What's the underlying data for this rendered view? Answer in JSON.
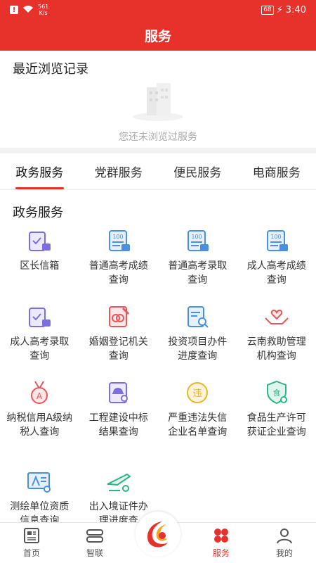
{
  "status_bar": {
    "speed_top": "561",
    "speed_bottom": "K/s",
    "battery": "68",
    "time": "3:40",
    "notification_icon": "!"
  },
  "header": {
    "title": "服务"
  },
  "recent": {
    "title": "最近浏览记录",
    "empty_text": "您还未浏览过服务"
  },
  "tabs": [
    {
      "label": "政务服务",
      "active": true
    },
    {
      "label": "党群服务",
      "active": false
    },
    {
      "label": "便民服务",
      "active": false
    },
    {
      "label": "电商服务",
      "active": false
    }
  ],
  "section": {
    "title": "政务服务"
  },
  "services": [
    {
      "label": "区长信箱",
      "icon": "mailbox-check-icon",
      "color": "#7b6fe0"
    },
    {
      "label": "普通高考成绩查询",
      "icon": "score-100-icon",
      "color": "#4a8fe0"
    },
    {
      "label": "普通高考录取查询",
      "icon": "score-100-icon",
      "color": "#4a8fe0"
    },
    {
      "label": "成人高考成绩查询",
      "icon": "score-100-icon",
      "color": "#4a8fe0"
    },
    {
      "label": "成人高考录取查询",
      "icon": "mailbox-check-icon",
      "color": "#7b6fe0"
    },
    {
      "label": "婚姻登记机关查询",
      "icon": "marriage-certificate-icon",
      "color": "#e8555a"
    },
    {
      "label": "投资项目办件进度查询",
      "icon": "document-search-icon",
      "color": "#4a8fe0"
    },
    {
      "label": "云南救助管理机构查询",
      "icon": "helping-hands-icon",
      "color": "#e8555a"
    },
    {
      "label": "纳税信用A级纳税人查询",
      "icon": "medal-a-icon",
      "color": "#e8555a"
    },
    {
      "label": "工程建设中标结果查询",
      "icon": "construction-search-icon",
      "color": "#7b6fe0"
    },
    {
      "label": "严重违法失信企业名单查询",
      "icon": "violation-badge-icon",
      "color": "#e8b62a"
    },
    {
      "label": "食品生产许可获证企业查询",
      "icon": "food-license-icon",
      "color": "#2fb38a"
    },
    {
      "label": "测绘单位资质信息查询",
      "icon": "surveying-icon",
      "color": "#4a8fe0"
    },
    {
      "label": "出入境证件办理进度查",
      "icon": "airplane-search-icon",
      "color": "#2fb38a"
    }
  ],
  "bottom_nav": [
    {
      "label": "首页",
      "icon": "newspaper-icon",
      "active": false
    },
    {
      "label": "智联",
      "icon": "layers-icon",
      "active": false
    },
    {
      "label": "",
      "icon": "center-logo-icon",
      "active": false
    },
    {
      "label": "服务",
      "icon": "grid-dots-icon",
      "active": true
    },
    {
      "label": "我的",
      "icon": "user-icon",
      "active": false
    }
  ],
  "colors": {
    "primary": "#e6322a",
    "text": "#222222",
    "muted": "#aaaaaa"
  }
}
